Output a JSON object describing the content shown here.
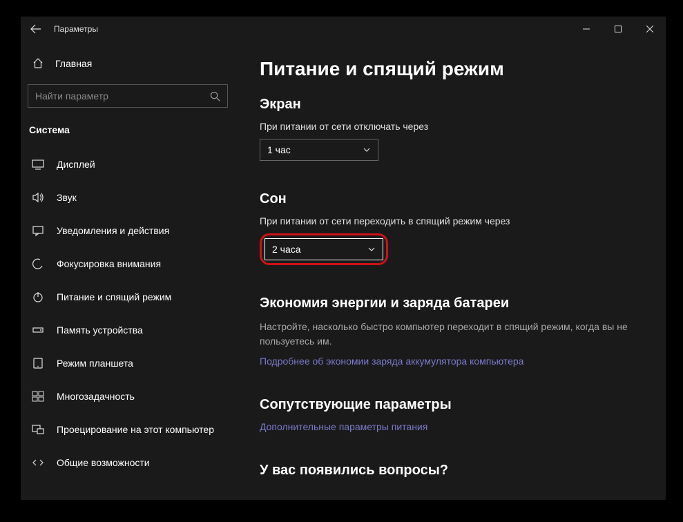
{
  "titlebar": {
    "app_title": "Параметры"
  },
  "sidebar": {
    "home_label": "Главная",
    "search_placeholder": "Найти параметр",
    "category": "Система",
    "items": [
      {
        "label": "Дисплей"
      },
      {
        "label": "Звук"
      },
      {
        "label": "Уведомления и действия"
      },
      {
        "label": "Фокусировка внимания"
      },
      {
        "label": "Питание и спящий режим"
      },
      {
        "label": "Память устройства"
      },
      {
        "label": "Режим планшета"
      },
      {
        "label": "Многозадачность"
      },
      {
        "label": "Проецирование на этот компьютер"
      },
      {
        "label": "Общие возможности"
      }
    ]
  },
  "main": {
    "title": "Питание и спящий режим",
    "screen": {
      "heading": "Экран",
      "label": "При питании от сети отключать через",
      "value": "1 час"
    },
    "sleep": {
      "heading": "Сон",
      "label": "При питании от сети переходить в спящий режим через",
      "value": "2 часа"
    },
    "battery": {
      "heading": "Экономия энергии и заряда батареи",
      "desc": "Настройте, насколько быстро компьютер переходит в спящий режим, когда вы не пользуетесь им.",
      "link": "Подробнее об экономии заряда аккумулятора компьютера"
    },
    "related": {
      "heading": "Сопутствующие параметры",
      "link": "Дополнительные параметры питания"
    },
    "questions": {
      "heading": "У вас появились вопросы?"
    }
  }
}
